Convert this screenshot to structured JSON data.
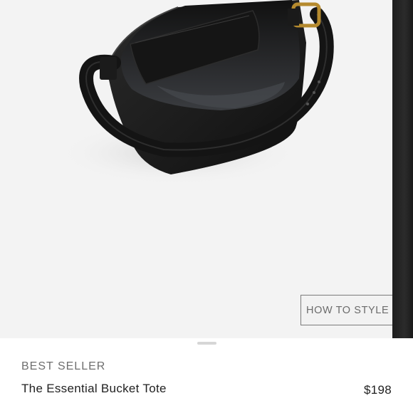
{
  "gallery": {
    "style_button_label": "HOW TO STYLE IT",
    "image_alt": "black leather bucket tote"
  },
  "product": {
    "badge": "BEST SELLER",
    "name": "The Essential Bucket Tote",
    "price": "$198"
  }
}
